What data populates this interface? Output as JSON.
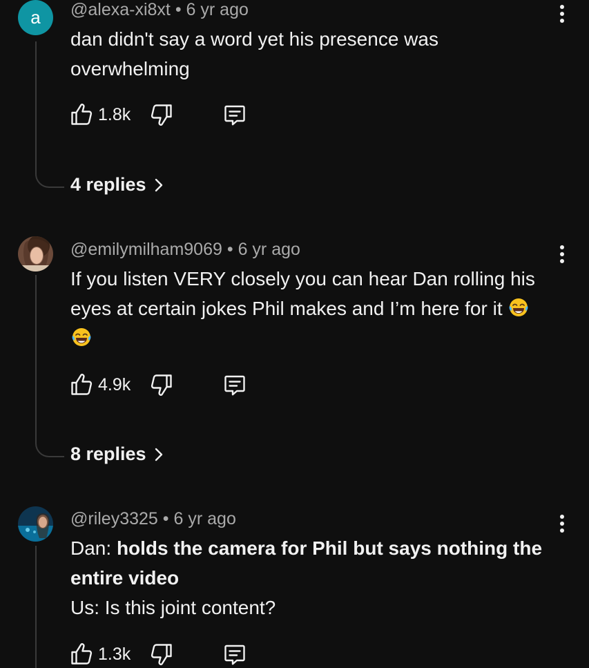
{
  "comments": [
    {
      "avatar_letter": "a",
      "avatar_color": "#0f95a3",
      "author": "@alexa-xi8xt",
      "separator": "•",
      "age": "6 yr ago",
      "text": "dan didn't say a word yet his presence was overwhelming",
      "likes": "1.8k",
      "replies": "4 replies"
    },
    {
      "author": "@emilymilham9069",
      "separator": "•",
      "age": "6 yr ago",
      "text": "If you listen VERY closely you can hear Dan rolling his eyes at certain jokes Phil makes and I’m here for it",
      "emojis": [
        "face-with-tears-of-joy",
        "face-with-tears-of-joy"
      ],
      "likes": "4.9k",
      "replies": "8 replies"
    },
    {
      "author": "@riley3325",
      "separator": "•",
      "age": "6 yr ago",
      "text_prefix": "Dan: ",
      "text_bold": "holds the camera for Phil but says nothing the entire video",
      "text_line2": "Us: Is this joint content?",
      "likes": "1.3k"
    }
  ],
  "icons": {
    "like": "thumbs-up-icon",
    "dislike": "thumbs-down-icon",
    "reply": "comment-reply-icon",
    "menu": "more-vertical-icon",
    "chevron": "chevron-right-icon"
  },
  "colors": {
    "background": "#0f0f0f",
    "primary_text": "#f1f1f1",
    "secondary_text": "#aaaaaa",
    "thread_line": "#3a3a3a"
  }
}
